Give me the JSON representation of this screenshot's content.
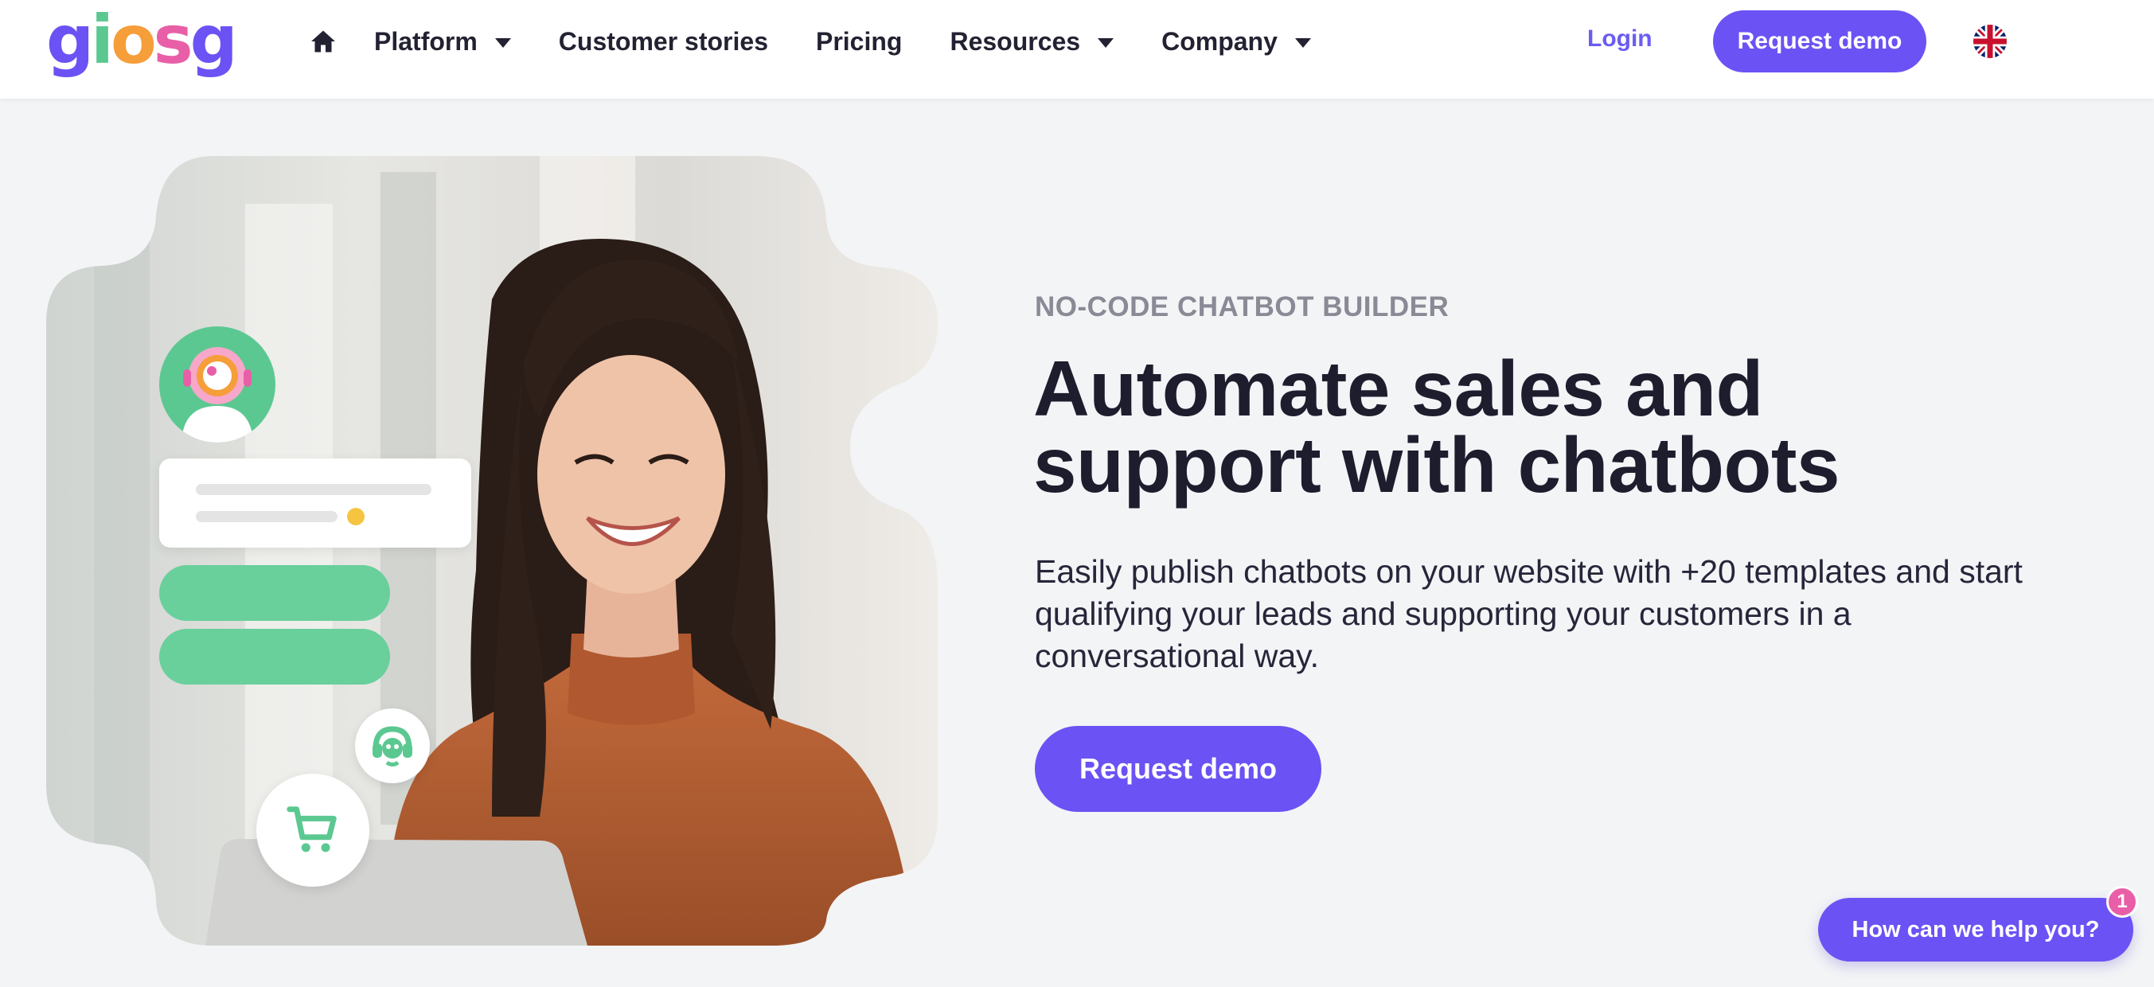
{
  "brand": {
    "logo_letters": [
      "g",
      "i",
      "o",
      "s",
      "g"
    ],
    "logo_colors": [
      "#6b52f4",
      "#5cc891",
      "#f59e3a",
      "#e85fa7",
      "#6b52f4"
    ]
  },
  "nav": {
    "home_icon": "home-icon",
    "items": [
      {
        "label": "Platform",
        "dropdown": true
      },
      {
        "label": "Customer stories",
        "dropdown": false
      },
      {
        "label": "Pricing",
        "dropdown": false
      },
      {
        "label": "Resources",
        "dropdown": true
      },
      {
        "label": "Company",
        "dropdown": true
      }
    ],
    "login_label": "Login",
    "demo_label": "Request demo",
    "language_icon": "uk-flag-icon"
  },
  "hero": {
    "eyebrow": "NO-CODE CHATBOT BUILDER",
    "headline_line1": "Automate sales and",
    "headline_line2": "support with chatbots",
    "subtext": "Easily publish chatbots on your website with +20 templates and start qualifying your leads and supporting your customers in a conversational way.",
    "cta_label": "Request demo"
  },
  "chat_widget": {
    "label": "How can we help you?",
    "badge_count": "1"
  },
  "colors": {
    "accent": "#6b52f4",
    "green": "#5cc891",
    "pink": "#e85fa7",
    "background": "#f3f4f6"
  }
}
